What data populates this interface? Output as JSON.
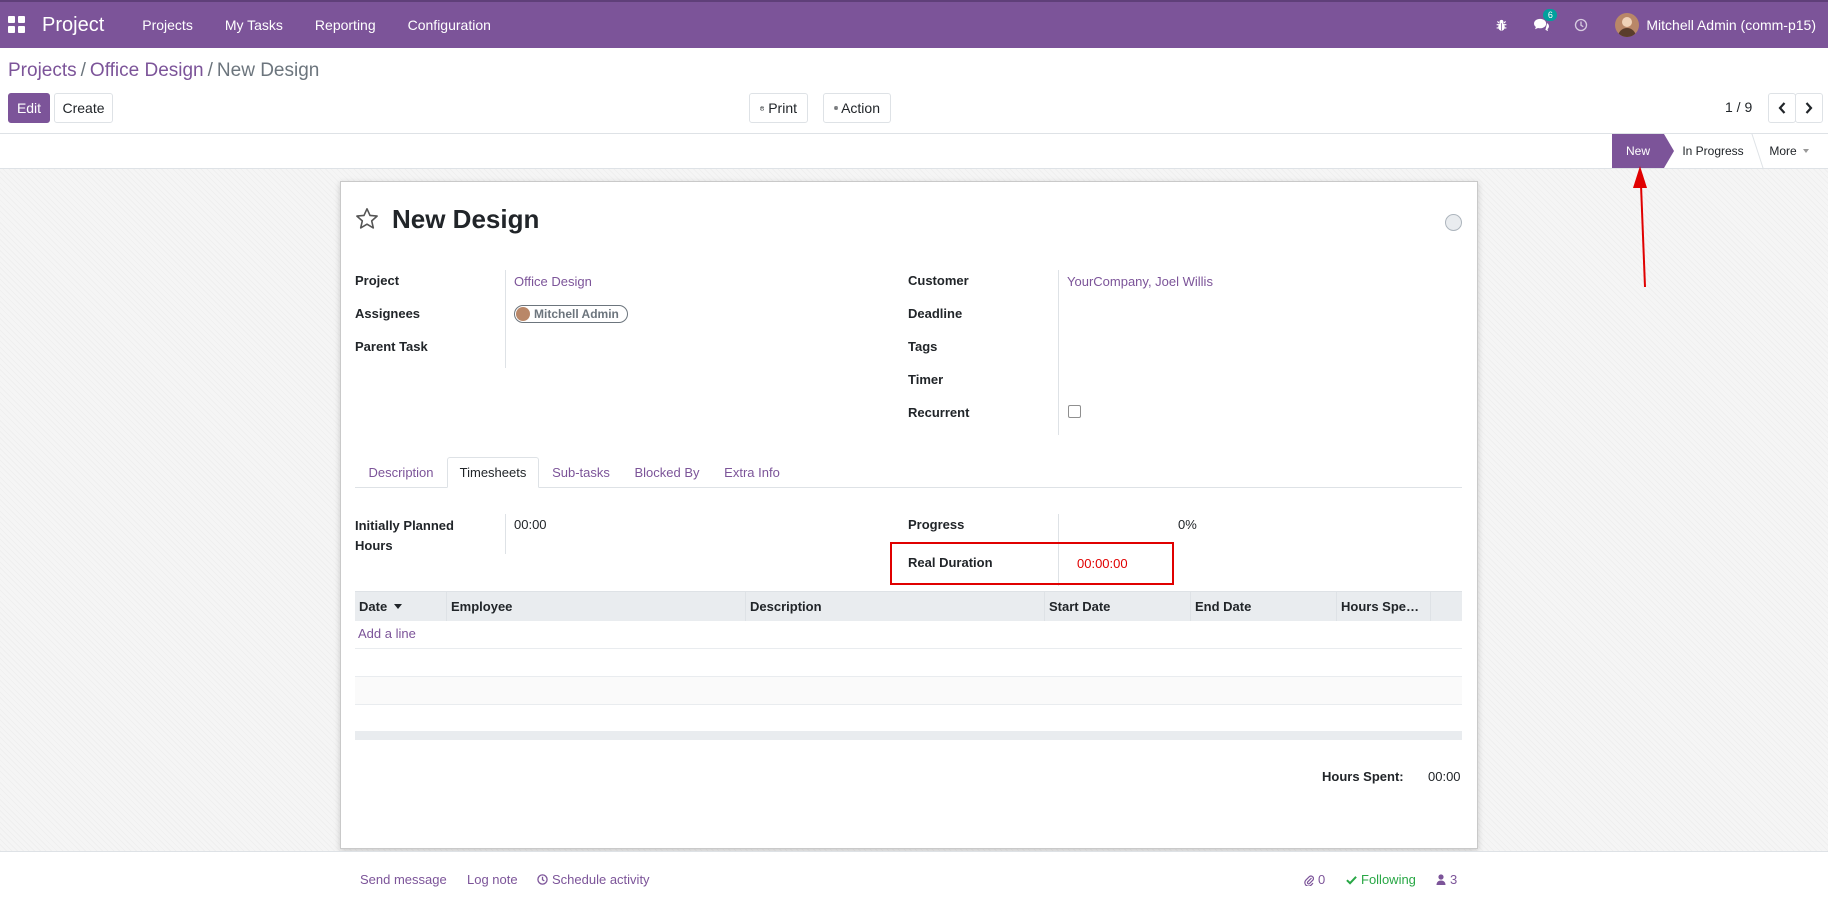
{
  "navbar": {
    "app_title": "Project",
    "menu": [
      "Projects",
      "My Tasks",
      "Reporting",
      "Configuration"
    ],
    "message_count": "6",
    "user_name": "Mitchell Admin (comm-p15)"
  },
  "breadcrumb": {
    "items": [
      "Projects",
      "Office Design"
    ],
    "sep": "/",
    "current": "New Design"
  },
  "toolbar": {
    "edit_label": "Edit",
    "create_label": "Create",
    "print_label": "Print",
    "action_label": "Action"
  },
  "pager": {
    "value": "1 / 9"
  },
  "statusbar": {
    "stages": [
      "New",
      "In Progress"
    ],
    "active_stage": "New",
    "more_label": "More"
  },
  "task": {
    "title": "New Design",
    "left_fields": [
      {
        "label": "Project",
        "value": "Office Design"
      },
      {
        "label": "Assignees",
        "value": "Mitchell Admin"
      },
      {
        "label": "Parent Task",
        "value": ""
      }
    ],
    "right_fields": [
      {
        "label": "Customer",
        "value": "YourCompany, Joel Willis"
      },
      {
        "label": "Deadline",
        "value": ""
      },
      {
        "label": "Tags",
        "value": ""
      },
      {
        "label": "Timer",
        "value": ""
      },
      {
        "label": "Recurrent",
        "value": ""
      }
    ]
  },
  "tabs": [
    "Description",
    "Timesheets",
    "Sub-tasks",
    "Blocked By",
    "Extra Info"
  ],
  "active_tab": "Timesheets",
  "timesheets": {
    "planned_label": "Initially Planned Hours",
    "planned_value": "00:00",
    "progress_label": "Progress",
    "progress_value": "0%",
    "real_duration_label": "Real Duration",
    "real_duration_value": "00:00:00",
    "columns": [
      "Date",
      "Employee",
      "Description",
      "Start Date",
      "End Date",
      "Hours Spe…"
    ],
    "add_line_label": "Add a line",
    "total_label": "Hours Spent:",
    "total_value": "00:00"
  },
  "chatter": {
    "send_message": "Send message",
    "log_note": "Log note",
    "schedule_activity": "Schedule activity",
    "attachments_count": "0",
    "following_label": "Following",
    "followers_count": "3"
  },
  "colors": {
    "brand": "#7c5499",
    "annotation": "#e00000",
    "following": "#28a745"
  }
}
